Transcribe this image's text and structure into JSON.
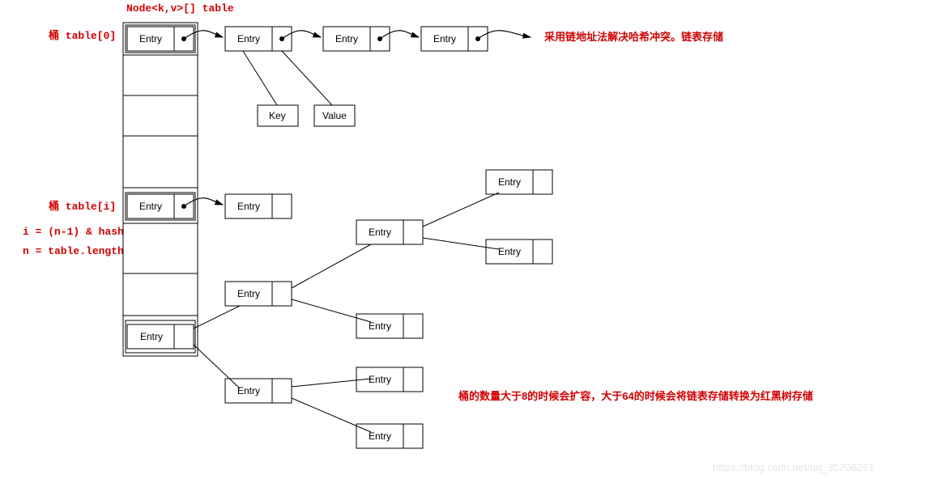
{
  "title": "Node<k,v>[] table",
  "bucket0": "桶 table[0]",
  "bucketI": "桶 table[i]",
  "formula1": "i = (n-1) & hash",
  "formula2": "n = table.length",
  "entry": "Entry",
  "key": "Key",
  "value": "Value",
  "chainNote": "采用链地址法解决哈希冲突。链表存储",
  "treeNote": "桶的数量大于8的时候会扩容，大于64的时候会将链表存储转换为红黑树存储",
  "watermark": "https://blog.csdn.net/qq_35206261"
}
